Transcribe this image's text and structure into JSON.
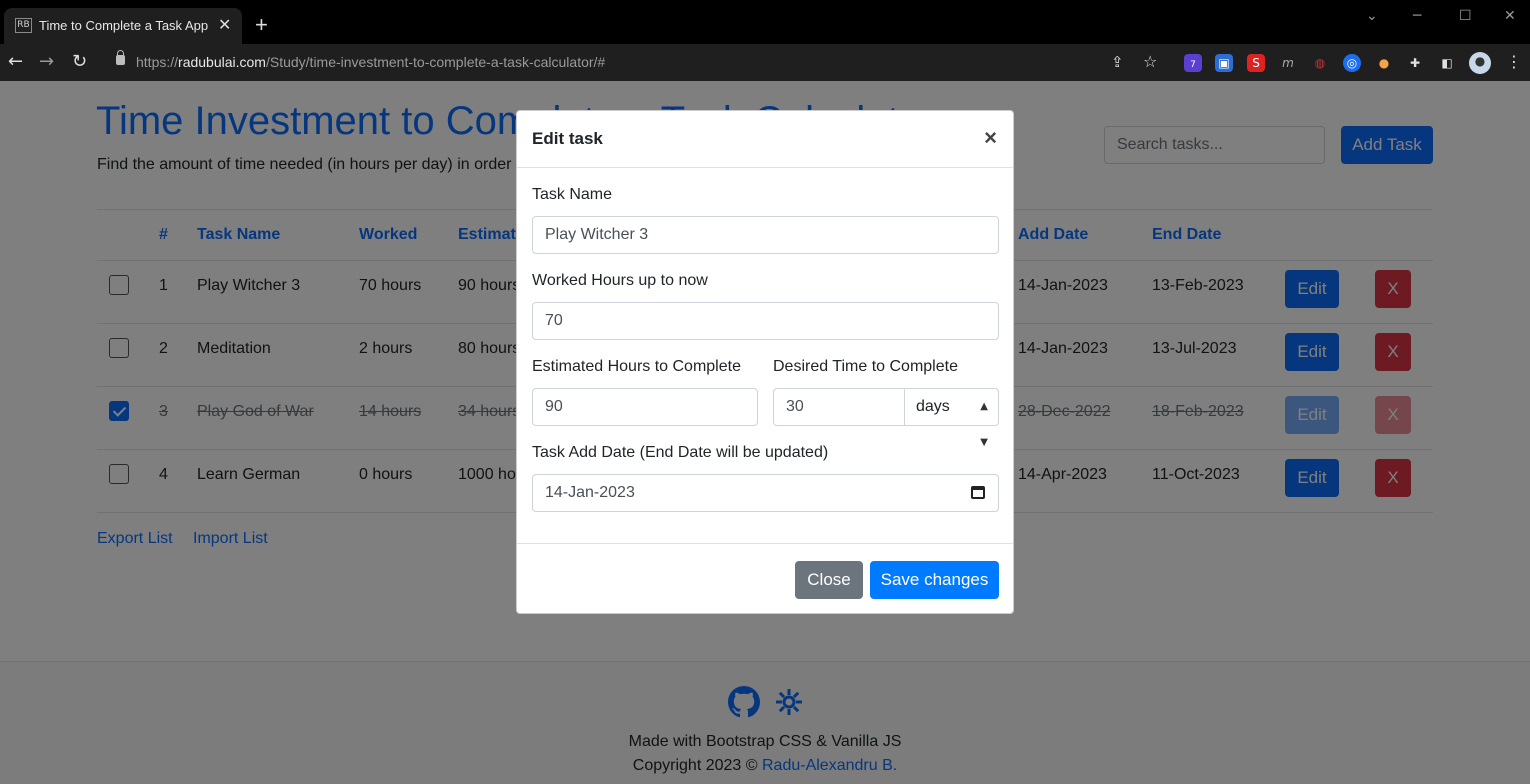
{
  "browser": {
    "tab_favicon": "RB",
    "tab_title": "Time to Complete a Task App",
    "tab_close": "✕",
    "new_tab": "+",
    "url_prefix": "https://",
    "url_host": "radubulai.com",
    "url_path": "/Study/time-investment-to-complete-a-task-calculator/#",
    "ext_badge": "7"
  },
  "header": {
    "title": "Time Investment to Complete a Task Calculator",
    "subtitle": "Find the amount of time needed (in hours per day) in order",
    "search_placeholder": "Search tasks...",
    "add_task_label": "Add Task"
  },
  "table": {
    "columns": [
      "#",
      "Task Name",
      "Worked",
      "Estimat",
      "Add Date",
      "End Date"
    ],
    "rows": [
      {
        "checked": false,
        "num": "1",
        "name": "Play Witcher 3",
        "worked": "70 hours",
        "estimated": "90 hours",
        "add_date": "14-Jan-2023",
        "end_date": "13-Feb-2023",
        "edit": "Edit",
        "delete": "X"
      },
      {
        "checked": false,
        "num": "2",
        "name": "Meditation",
        "worked": "2 hours",
        "estimated": "80 hours",
        "add_date": "14-Jan-2023",
        "end_date": "13-Jul-2023",
        "edit": "Edit",
        "delete": "X"
      },
      {
        "checked": true,
        "num": "3",
        "name": "Play God of War",
        "worked": "14 hours",
        "estimated": "34 hours",
        "add_date": "28-Dec-2022",
        "end_date": "18-Feb-2023",
        "edit": "Edit",
        "delete": "X"
      },
      {
        "checked": false,
        "num": "4",
        "name": "Learn German",
        "worked": "0 hours",
        "estimated": "1000 ho",
        "add_date": "14-Apr-2023",
        "end_date": "11-Oct-2023",
        "edit": "Edit",
        "delete": "X"
      }
    ]
  },
  "links": {
    "export": "Export List",
    "import": "Import List"
  },
  "footer": {
    "made_with": "Made with Bootstrap CSS & Vanilla JS",
    "copyright_prefix": "Copyright 2023 © ",
    "author": "Radu-Alexandru B."
  },
  "modal": {
    "title": "Edit task",
    "close_x": "×",
    "task_name_label": "Task Name",
    "task_name_value": "Play Witcher 3",
    "worked_label": "Worked Hours up to now",
    "worked_value": "70",
    "estimated_label": "Estimated Hours to Complete",
    "estimated_value": "90",
    "desired_label": "Desired Time to Complete",
    "desired_value": "30",
    "desired_unit": "days",
    "add_date_label": "Task Add Date (End Date will be updated)",
    "add_date_value": "14-Jan-2023",
    "close_label": "Close",
    "save_label": "Save changes"
  },
  "colors": {
    "primary": "#0d6efd",
    "danger": "#dc3545",
    "secondary": "#6c757d"
  }
}
